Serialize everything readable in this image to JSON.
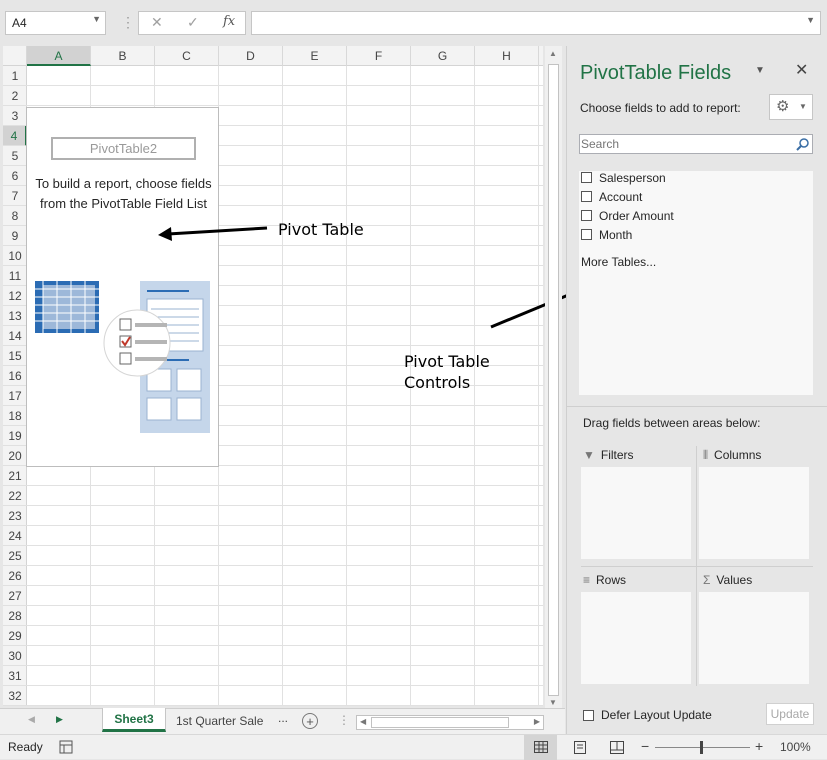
{
  "formula_bar": {
    "name_box": "A4",
    "cancel_icon": "✕",
    "enter_icon": "✓",
    "function_icon": "fx",
    "formula": ""
  },
  "grid": {
    "columns": [
      "A",
      "B",
      "C",
      "D",
      "E",
      "F",
      "G",
      "H"
    ],
    "rows": [
      "1",
      "2",
      "3",
      "4",
      "5",
      "6",
      "7",
      "8",
      "9",
      "10",
      "11",
      "12",
      "13",
      "14",
      "15",
      "16",
      "17",
      "18",
      "19",
      "20",
      "21",
      "22",
      "23",
      "24",
      "25",
      "26",
      "27",
      "28",
      "29",
      "30",
      "31",
      "32"
    ],
    "selected_column": "A",
    "selected_row": "4"
  },
  "pivot_placeholder": {
    "name": "PivotTable2",
    "message": "To build a report, choose fields from the PivotTable Field List"
  },
  "annotations": {
    "pivot_table": "Pivot Table",
    "pivot_table_controls_line1": "Pivot Table",
    "pivot_table_controls_line2": "Controls"
  },
  "sheet_tabs": {
    "active": "Sheet3",
    "other": "1st Quarter Sale",
    "overflow": "..."
  },
  "status": {
    "mode": "Ready",
    "zoom": "100%"
  },
  "pane": {
    "title": "PivotTable Fields",
    "choose_label": "Choose fields to add to report:",
    "search_placeholder": "Search",
    "fields": [
      "Salesperson",
      "Account",
      "Order Amount",
      "Month"
    ],
    "more_tables": "More Tables...",
    "drag_label": "Drag fields between areas below:",
    "areas": {
      "filters": "Filters",
      "columns": "Columns",
      "rows": "Rows",
      "values": "Values"
    },
    "defer_label": "Defer Layout Update",
    "update_button": "Update"
  },
  "colors": {
    "accent": "#217346",
    "selection": "#217346",
    "pane_bg": "#e6e6e6"
  }
}
